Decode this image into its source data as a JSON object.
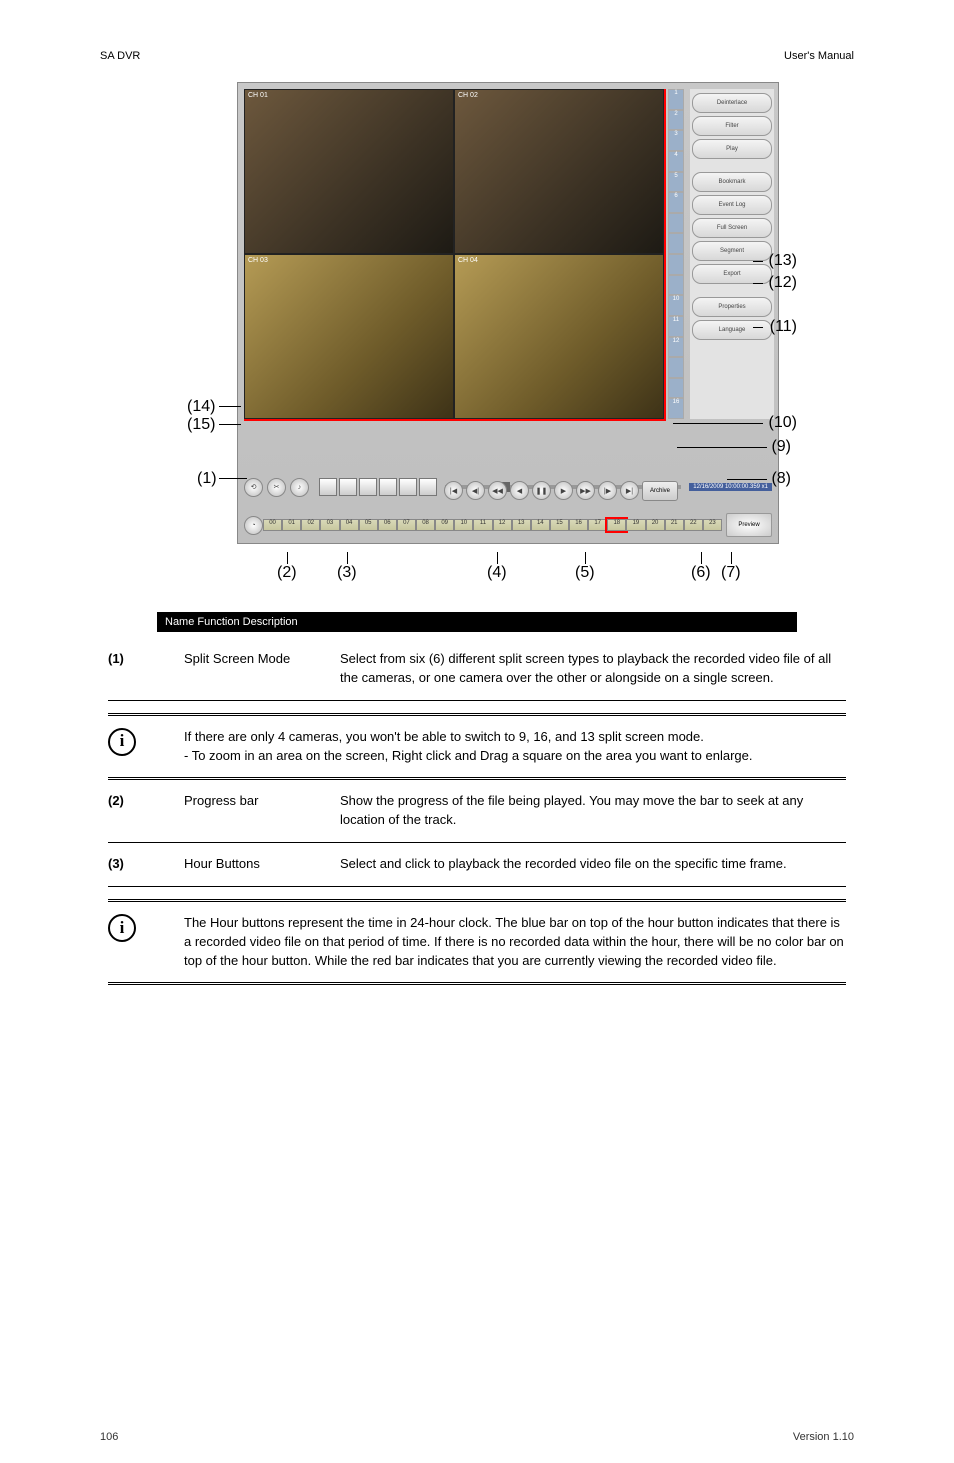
{
  "header": {
    "left": "SA DVR",
    "right": "User's Manual"
  },
  "app": {
    "cams": [
      "CH 01",
      "CH 02",
      "CH 03",
      "CH 04"
    ],
    "side_cells": [
      "1",
      "2",
      "3",
      "4",
      "5",
      "6",
      "",
      "",
      "",
      "",
      "10",
      "11",
      "12",
      "",
      "",
      "16"
    ],
    "right_buttons": [
      "Deinterlace",
      "Filter",
      "Play",
      "Bookmark",
      "Event Log",
      "Full Screen",
      "Segment",
      "Export",
      "Properties",
      "Language"
    ],
    "timestamp_bar": "12/16/2009 10:00:00.359  x1",
    "archive": "Archive",
    "preview": "Preview",
    "hours": [
      "00",
      "01",
      "02",
      "03",
      "04",
      "05",
      "06",
      "07",
      "08",
      "09",
      "10",
      "11",
      "12",
      "13",
      "14",
      "15",
      "16",
      "17",
      "18",
      "19",
      "20",
      "21",
      "22",
      "23"
    ]
  },
  "callouts": {
    "l1": "(1)",
    "l14": "(14)",
    "l15": "(15)",
    "r8": "(8)",
    "r9": "(9)",
    "r10": "(10)",
    "r11": "(11)",
    "r12": "(12)",
    "r13": "(13)",
    "b2": "(2)",
    "b3": "(3)",
    "b4": "(4)",
    "b5": "(5)",
    "b6": "(6)",
    "b7": "(7)"
  },
  "black_bar": "Name          Function          Description",
  "rows": [
    {
      "n": "(1)",
      "func": "Split Screen Mode",
      "desc": "Select from six (6) different split screen types to playback the recorded video file of all the cameras, or one camera over the other or alongside on a single screen."
    },
    {
      "n": "",
      "func": "info",
      "desc": "If there are only 4 cameras, you won't be able to switch to 9, 16, and 13 split screen mode.\n- To zoom in an area on the screen, Right click and Drag a square on the area you want to enlarge."
    },
    {
      "n": "(2)",
      "func": "Progress bar",
      "desc": "Show the progress of the file being played. You may move the bar to seek at any location of the track."
    },
    {
      "n": "(3)",
      "func": "Hour Buttons",
      "desc": "Select and click to playback the recorded video file on the specific time frame."
    },
    {
      "n": "",
      "func": "info",
      "desc": "The Hour buttons represent the time in 24-hour clock. The blue bar on top of the hour button indicates that there is a recorded video file on that period of time. If there is no recorded data within the hour, there will be no color bar on top of the hour button. While the red bar indicates that you are currently viewing the recorded video file."
    }
  ],
  "footer": {
    "left": "106",
    "right": "Version 1.10"
  }
}
